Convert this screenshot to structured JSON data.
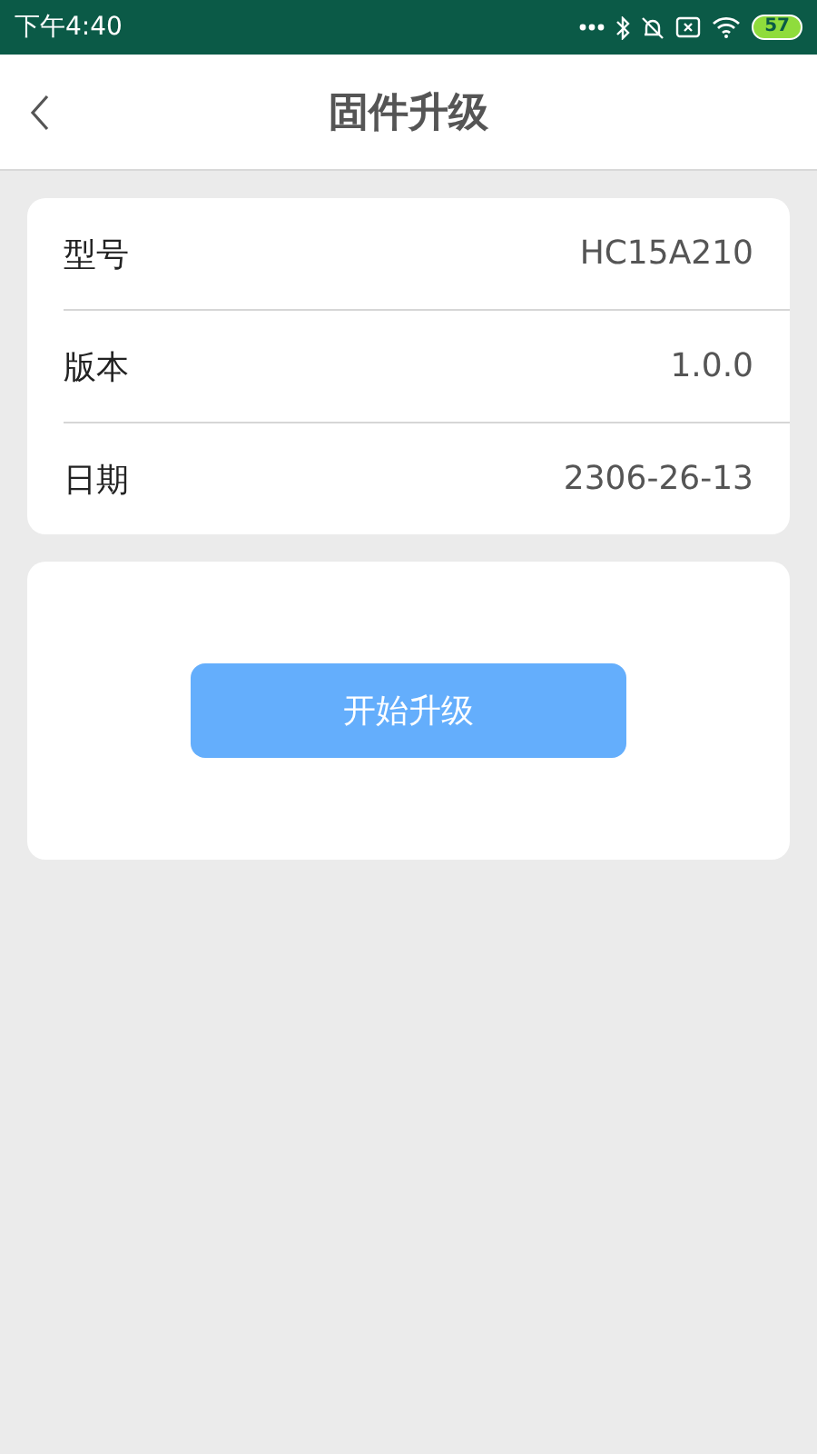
{
  "status_bar": {
    "time": "下午4:40",
    "battery": "57"
  },
  "header": {
    "title": "固件升级"
  },
  "info": [
    {
      "label": "型号",
      "value": "HC15A210"
    },
    {
      "label": "版本",
      "value": "1.0.0"
    },
    {
      "label": "日期",
      "value": "2306-26-13"
    }
  ],
  "upgrade_button": {
    "label": "开始升级"
  }
}
